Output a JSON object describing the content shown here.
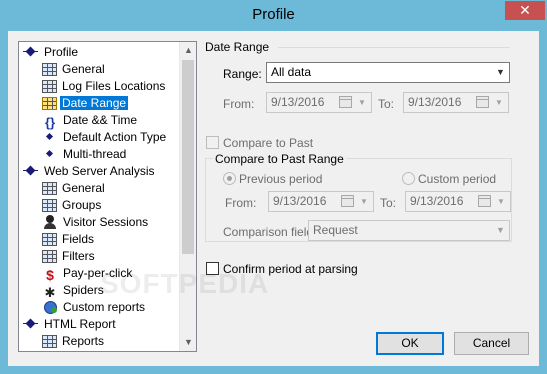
{
  "window": {
    "title": "Profile",
    "close_glyph": "✕"
  },
  "tree": {
    "items": [
      {
        "label": "Profile",
        "icon": "diamond-icon",
        "level": 0,
        "selected": false
      },
      {
        "label": "General",
        "icon": "grid-icon",
        "level": 1,
        "selected": false
      },
      {
        "label": "Log Files Locations",
        "icon": "grid-icon",
        "level": 1,
        "selected": false
      },
      {
        "label": "Date Range",
        "icon": "calendar-grid-icon",
        "level": 1,
        "selected": true
      },
      {
        "label": "Date && Time",
        "icon": "braces-icon",
        "level": 1,
        "selected": false
      },
      {
        "label": "Default Action Type",
        "icon": "small-diamond-icon",
        "level": 1,
        "selected": false
      },
      {
        "label": "Multi-thread",
        "icon": "small-diamond-icon",
        "level": 1,
        "selected": false
      },
      {
        "label": "Web Server Analysis",
        "icon": "diamond-icon",
        "level": 0,
        "selected": false
      },
      {
        "label": "General",
        "icon": "grid-icon",
        "level": 1,
        "selected": false
      },
      {
        "label": "Groups",
        "icon": "grid-icon",
        "level": 1,
        "selected": false
      },
      {
        "label": "Visitor Sessions",
        "icon": "person-icon",
        "level": 1,
        "selected": false
      },
      {
        "label": "Fields",
        "icon": "grid-icon",
        "level": 1,
        "selected": false
      },
      {
        "label": "Filters",
        "icon": "grid-icon",
        "level": 1,
        "selected": false
      },
      {
        "label": "Pay-per-click",
        "icon": "pay-per-click-icon",
        "level": 1,
        "selected": false
      },
      {
        "label": "Spiders",
        "icon": "spider-icon",
        "level": 1,
        "selected": false
      },
      {
        "label": "Custom reports",
        "icon": "custom-report-icon",
        "level": 1,
        "selected": false
      },
      {
        "label": "HTML Report",
        "icon": "diamond-icon",
        "level": 0,
        "selected": false
      },
      {
        "label": "Reports",
        "icon": "grid-icon",
        "level": 1,
        "selected": false
      }
    ]
  },
  "date_range": {
    "heading": "Date Range",
    "range_label": "Range:",
    "range_value": "All data",
    "from_label": "From:",
    "from_value": "9/13/2016",
    "to_label": "To:",
    "to_value": "9/13/2016"
  },
  "compare": {
    "checkbox_label": "Compare to Past",
    "checked": false
  },
  "compare_range": {
    "heading": "Compare to Past Range",
    "previous_period_label": "Previous period",
    "custom_period_label": "Custom period",
    "selected": "previous_period",
    "from_label": "From:",
    "from_value": "9/13/2016",
    "to_label": "To:",
    "to_value": "9/13/2016",
    "comparison_field_label": "Comparison field:",
    "comparison_field_value": "Request"
  },
  "confirm": {
    "checkbox_label": "Confirm period at parsing",
    "checked": false
  },
  "buttons": {
    "ok": "OK",
    "cancel": "Cancel"
  },
  "watermark": "SOFTPEDIA",
  "colors": {
    "titlebar": "#6cbad8",
    "close": "#c75050",
    "selection": "#0078d7",
    "default_button_border": "#0078d7"
  }
}
